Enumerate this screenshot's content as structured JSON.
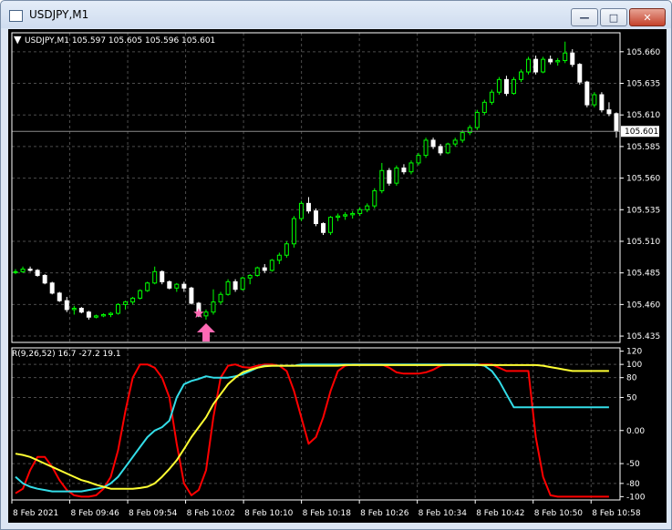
{
  "window": {
    "title": "USDJPY,M1"
  },
  "price_panel": {
    "info": "USDJPY,M1  105.597 105.605 105.596 105.601",
    "current_price": "105.601",
    "y_ticks": [
      "105.660",
      "105.635",
      "105.610",
      "105.585",
      "105.560",
      "105.535",
      "105.510",
      "105.485",
      "105.460",
      "105.435"
    ]
  },
  "indicator_panel": {
    "info": "R(9,26,52) 16.7 -27.2 19.1",
    "y_ticks": [
      "120",
      "100",
      "80",
      "50",
      "0.00",
      "-50",
      "-80",
      "-100"
    ]
  },
  "x_axis": {
    "labels": [
      "8 Feb 2021",
      "8 Feb 09:46",
      "8 Feb 09:54",
      "8 Feb 10:02",
      "8 Feb 10:10",
      "8 Feb 10:18",
      "8 Feb 10:26",
      "8 Feb 10:34",
      "8 Feb 10:42",
      "8 Feb 10:50",
      "8 Feb 10:58"
    ]
  },
  "colors": {
    "bull": "#00ff00",
    "bear": "#ffffff",
    "red_line": "#ff0000",
    "cyan_line": "#33dde8",
    "yellow_line": "#ffff33",
    "marker": "#ff69b4"
  },
  "chart_data": [
    {
      "type": "candlestick",
      "title": "USDJPY,M1",
      "ylim": [
        105.43,
        105.675
      ],
      "candles": [
        [
          105.486,
          105.488,
          105.484,
          105.486
        ],
        [
          105.486,
          105.49,
          105.485,
          105.488
        ],
        [
          105.488,
          105.49,
          105.486,
          105.487
        ],
        [
          105.487,
          105.488,
          105.482,
          105.483
        ],
        [
          105.483,
          105.484,
          105.476,
          105.477
        ],
        [
          105.477,
          105.478,
          105.468,
          105.469
        ],
        [
          105.469,
          105.47,
          105.462,
          105.463
        ],
        [
          105.463,
          105.466,
          105.454,
          105.456
        ],
        [
          105.456,
          105.459,
          105.452,
          105.457
        ],
        [
          105.457,
          105.458,
          105.453,
          105.454
        ],
        [
          105.454,
          105.455,
          105.448,
          105.45
        ],
        [
          105.45,
          105.452,
          105.449,
          105.451
        ],
        [
          105.451,
          105.453,
          105.45,
          105.452
        ],
        [
          105.452,
          105.454,
          105.45,
          105.453
        ],
        [
          105.453,
          105.461,
          105.452,
          105.46
        ],
        [
          105.46,
          105.463,
          105.456,
          105.462
        ],
        [
          105.462,
          105.466,
          105.46,
          105.465
        ],
        [
          105.465,
          105.472,
          105.464,
          105.471
        ],
        [
          105.471,
          105.478,
          105.47,
          105.477
        ],
        [
          105.477,
          105.49,
          105.476,
          105.486
        ],
        [
          105.486,
          105.487,
          105.476,
          105.478
        ],
        [
          105.478,
          105.479,
          105.472,
          105.473
        ],
        [
          105.473,
          105.477,
          105.47,
          105.476
        ],
        [
          105.476,
          105.478,
          105.47,
          105.473
        ],
        [
          105.473,
          105.474,
          105.46,
          105.461
        ],
        [
          105.461,
          105.462,
          105.45,
          105.451
        ],
        [
          105.451,
          105.456,
          105.448,
          105.454
        ],
        [
          105.454,
          105.472,
          105.452,
          105.462
        ],
        [
          105.462,
          105.47,
          105.46,
          105.468
        ],
        [
          105.468,
          105.48,
          105.467,
          105.478
        ],
        [
          105.478,
          105.48,
          105.47,
          105.472
        ],
        [
          105.472,
          105.482,
          105.471,
          105.481
        ],
        [
          105.481,
          105.484,
          105.476,
          105.483
        ],
        [
          105.483,
          105.49,
          105.482,
          105.489
        ],
        [
          105.489,
          105.492,
          105.485,
          105.487
        ],
        [
          105.487,
          105.496,
          105.486,
          105.495
        ],
        [
          105.495,
          105.501,
          105.492,
          105.499
        ],
        [
          105.499,
          105.51,
          105.497,
          105.508
        ],
        [
          105.508,
          105.53,
          105.505,
          105.528
        ],
        [
          105.528,
          105.542,
          105.526,
          105.54
        ],
        [
          105.54,
          105.545,
          105.532,
          105.534
        ],
        [
          105.534,
          105.536,
          105.522,
          105.524
        ],
        [
          105.524,
          105.525,
          105.515,
          105.517
        ],
        [
          105.517,
          105.53,
          105.515,
          105.529
        ],
        [
          105.529,
          105.532,
          105.526,
          105.53
        ],
        [
          105.53,
          105.533,
          105.527,
          105.531
        ],
        [
          105.531,
          105.534,
          105.528,
          105.532
        ],
        [
          105.532,
          105.537,
          105.53,
          105.535
        ],
        [
          105.535,
          105.54,
          105.533,
          105.538
        ],
        [
          105.538,
          105.552,
          105.536,
          105.55
        ],
        [
          105.55,
          105.572,
          105.548,
          105.566
        ],
        [
          105.566,
          105.568,
          105.554,
          105.556
        ],
        [
          105.556,
          105.57,
          105.554,
          105.568
        ],
        [
          105.568,
          105.571,
          105.563,
          105.565
        ],
        [
          105.565,
          105.574,
          105.563,
          105.572
        ],
        [
          105.572,
          105.58,
          105.57,
          105.578
        ],
        [
          105.578,
          105.592,
          105.576,
          105.59
        ],
        [
          105.59,
          105.592,
          105.583,
          105.585
        ],
        [
          105.585,
          105.587,
          105.578,
          105.58
        ],
        [
          105.58,
          105.588,
          105.579,
          105.587
        ],
        [
          105.587,
          105.592,
          105.585,
          105.59
        ],
        [
          105.59,
          105.598,
          105.588,
          105.596
        ],
        [
          105.596,
          105.602,
          105.594,
          105.6
        ],
        [
          105.6,
          105.614,
          105.598,
          105.612
        ],
        [
          105.612,
          105.622,
          105.61,
          105.62
        ],
        [
          105.62,
          105.63,
          105.618,
          105.628
        ],
        [
          105.628,
          105.64,
          105.626,
          105.638
        ],
        [
          105.638,
          105.641,
          105.625,
          105.627
        ],
        [
          105.627,
          105.64,
          105.626,
          105.638
        ],
        [
          105.638,
          105.646,
          105.636,
          105.644
        ],
        [
          105.644,
          105.656,
          105.642,
          105.654
        ],
        [
          105.654,
          105.657,
          105.642,
          105.644
        ],
        [
          105.644,
          105.656,
          105.643,
          105.654
        ],
        [
          105.654,
          105.657,
          105.65,
          105.652
        ],
        [
          105.652,
          105.655,
          105.649,
          105.653
        ],
        [
          105.653,
          105.668,
          105.651,
          105.659
        ],
        [
          105.659,
          105.662,
          105.648,
          105.65
        ],
        [
          105.65,
          105.651,
          105.634,
          105.636
        ],
        [
          105.636,
          105.637,
          105.616,
          105.618
        ],
        [
          105.618,
          105.628,
          105.616,
          105.626
        ],
        [
          105.626,
          105.628,
          105.612,
          105.614
        ],
        [
          105.614,
          105.62,
          105.609,
          105.611
        ],
        [
          105.611,
          105.612,
          105.592,
          105.597
        ]
      ],
      "markers": [
        {
          "bar": 25,
          "kind": "star"
        },
        {
          "bar": 26,
          "kind": "buy-arrow"
        }
      ]
    },
    {
      "type": "line",
      "title": "R(9,26,52)",
      "ylim": [
        -105,
        125
      ],
      "series": [
        {
          "values": [
            -95,
            -88,
            -60,
            -40,
            -40,
            -55,
            -75,
            -90,
            -98,
            -100,
            -100,
            -98,
            -88,
            -70,
            -30,
            30,
            80,
            100,
            100,
            95,
            80,
            50,
            -20,
            -80,
            -98,
            -90,
            -60,
            20,
            80,
            98,
            100,
            96,
            95,
            98,
            100,
            100,
            98,
            90,
            60,
            20,
            -20,
            -10,
            20,
            60,
            90,
            98,
            100,
            100,
            100,
            100,
            100,
            95,
            88,
            86,
            86,
            86,
            88,
            92,
            98,
            100,
            100,
            100,
            100,
            100,
            100,
            100,
            95,
            90,
            90,
            90,
            90,
            -10,
            -70,
            -98,
            -100,
            -100,
            -100,
            -100,
            -100,
            -100,
            -100,
            -100
          ]
        },
        {
          "values": [
            -70,
            -80,
            -85,
            -88,
            -90,
            -92,
            -92,
            -92,
            -92,
            -92,
            -90,
            -88,
            -86,
            -80,
            -70,
            -55,
            -40,
            -25,
            -10,
            0,
            5,
            15,
            50,
            70,
            75,
            78,
            82,
            80,
            80,
            80,
            82,
            85,
            90,
            95,
            98,
            98,
            98,
            98,
            98,
            100,
            100,
            100,
            100,
            100,
            100,
            100,
            100,
            100,
            100,
            100,
            100,
            100,
            100,
            100,
            100,
            100,
            100,
            100,
            100,
            100,
            100,
            100,
            100,
            100,
            98,
            90,
            75,
            55,
            35,
            35,
            35,
            35,
            35,
            35,
            35,
            35,
            35,
            35,
            35,
            35,
            35,
            35
          ]
        },
        {
          "values": [
            -35,
            -37,
            -40,
            -45,
            -50,
            -55,
            -60,
            -65,
            -70,
            -75,
            -78,
            -82,
            -85,
            -88,
            -88,
            -88,
            -88,
            -87,
            -85,
            -80,
            -70,
            -58,
            -45,
            -28,
            -10,
            5,
            20,
            40,
            55,
            70,
            80,
            88,
            92,
            95,
            97,
            98,
            98,
            98,
            98,
            98,
            98,
            98,
            98,
            98,
            98,
            99,
            99,
            99,
            99,
            99,
            99,
            99,
            99,
            99,
            99,
            99,
            99,
            99,
            99,
            99,
            99,
            99,
            99,
            99,
            99,
            99,
            99,
            99,
            99,
            99,
            99,
            99,
            98,
            96,
            94,
            92,
            90,
            90,
            90,
            90,
            90,
            90
          ]
        }
      ]
    }
  ]
}
